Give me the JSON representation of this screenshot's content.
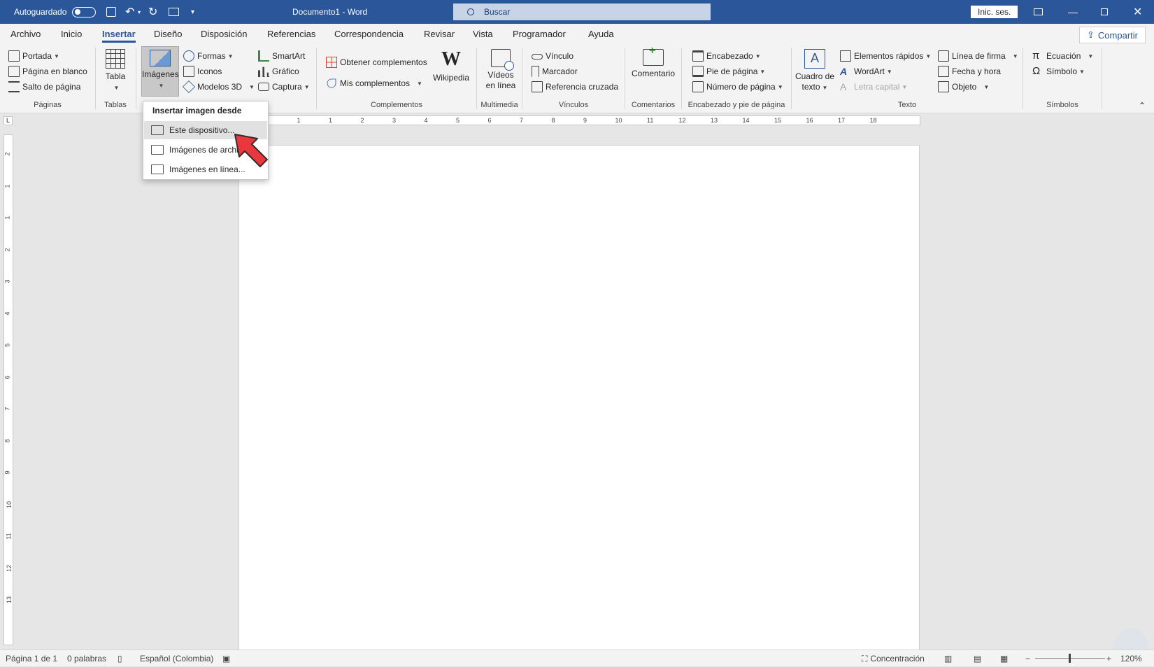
{
  "titlebar": {
    "autosave": "Autoguardado",
    "doc_title": "Documento1  -  Word",
    "search_placeholder": "Buscar",
    "signin": "Inic. ses."
  },
  "menu": {
    "tabs": [
      "Archivo",
      "Inicio",
      "Insertar",
      "Diseño",
      "Disposición",
      "Referencias",
      "Correspondencia",
      "Revisar",
      "Vista",
      "Programador",
      "Ayuda"
    ],
    "active": "Insertar",
    "share": "Compartir"
  },
  "ribbon": {
    "paginas": {
      "portada": "Portada",
      "pagina_blanco": "Página en blanco",
      "salto": "Salto de página",
      "label": "Páginas"
    },
    "tablas": {
      "tabla": "Tabla",
      "label": "Tablas"
    },
    "ilustraciones": {
      "imagenes": "Imágenes",
      "formas": "Formas",
      "iconos": "Iconos",
      "modelos": "Modelos 3D",
      "smartart": "SmartArt",
      "grafico": "Gráfico",
      "captura": "Captura"
    },
    "complementos": {
      "obtener": "Obtener complementos",
      "mis": "Mis complementos",
      "wikipedia": "Wikipedia",
      "label": "Complementos"
    },
    "multimedia": {
      "videos1": "Vídeos",
      "videos2": "en línea",
      "label": "Multimedia"
    },
    "vinculos": {
      "vinculo": "Vínculo",
      "marcador": "Marcador",
      "referencia": "Referencia cruzada",
      "label": "Vínculos"
    },
    "comentarios": {
      "comentario": "Comentario",
      "label": "Comentarios"
    },
    "encabezado": {
      "encabezado": "Encabezado",
      "pie": "Pie de página",
      "numero": "Número de página",
      "label": "Encabezado y pie de página"
    },
    "texto": {
      "cuadro1": "Cuadro de",
      "cuadro2": "texto",
      "elementos": "Elementos rápidos",
      "wordart": "WordArt",
      "letra": "Letra capital",
      "linea": "Línea de firma",
      "fecha": "Fecha y hora",
      "objeto": "Objeto",
      "label": "Texto"
    },
    "simbolos": {
      "ecuacion": "Ecuación",
      "simbolo": "Símbolo",
      "label": "Símbolos"
    }
  },
  "dropdown": {
    "title": "Insertar imagen desde",
    "items": [
      "Este dispositivo...",
      "Imágenes de archivo...",
      "Imágenes en línea..."
    ]
  },
  "ruler": {
    "h_ticks": [
      "2",
      "1",
      "1",
      "2",
      "3",
      "4",
      "5",
      "6",
      "7",
      "8",
      "9",
      "10",
      "11",
      "12",
      "13",
      "14",
      "15",
      "16",
      "17",
      "18"
    ],
    "v_ticks": [
      "2",
      "1",
      "1",
      "2",
      "3",
      "4",
      "5",
      "6",
      "7",
      "8",
      "9",
      "10",
      "11",
      "12",
      "13"
    ]
  },
  "status": {
    "page": "Página 1 de 1",
    "words": "0 palabras",
    "language": "Español (Colombia)",
    "focus": "Concentración",
    "zoom": "120%"
  },
  "colors": {
    "accent": "#2b579a",
    "pointer": "#e8383d"
  }
}
